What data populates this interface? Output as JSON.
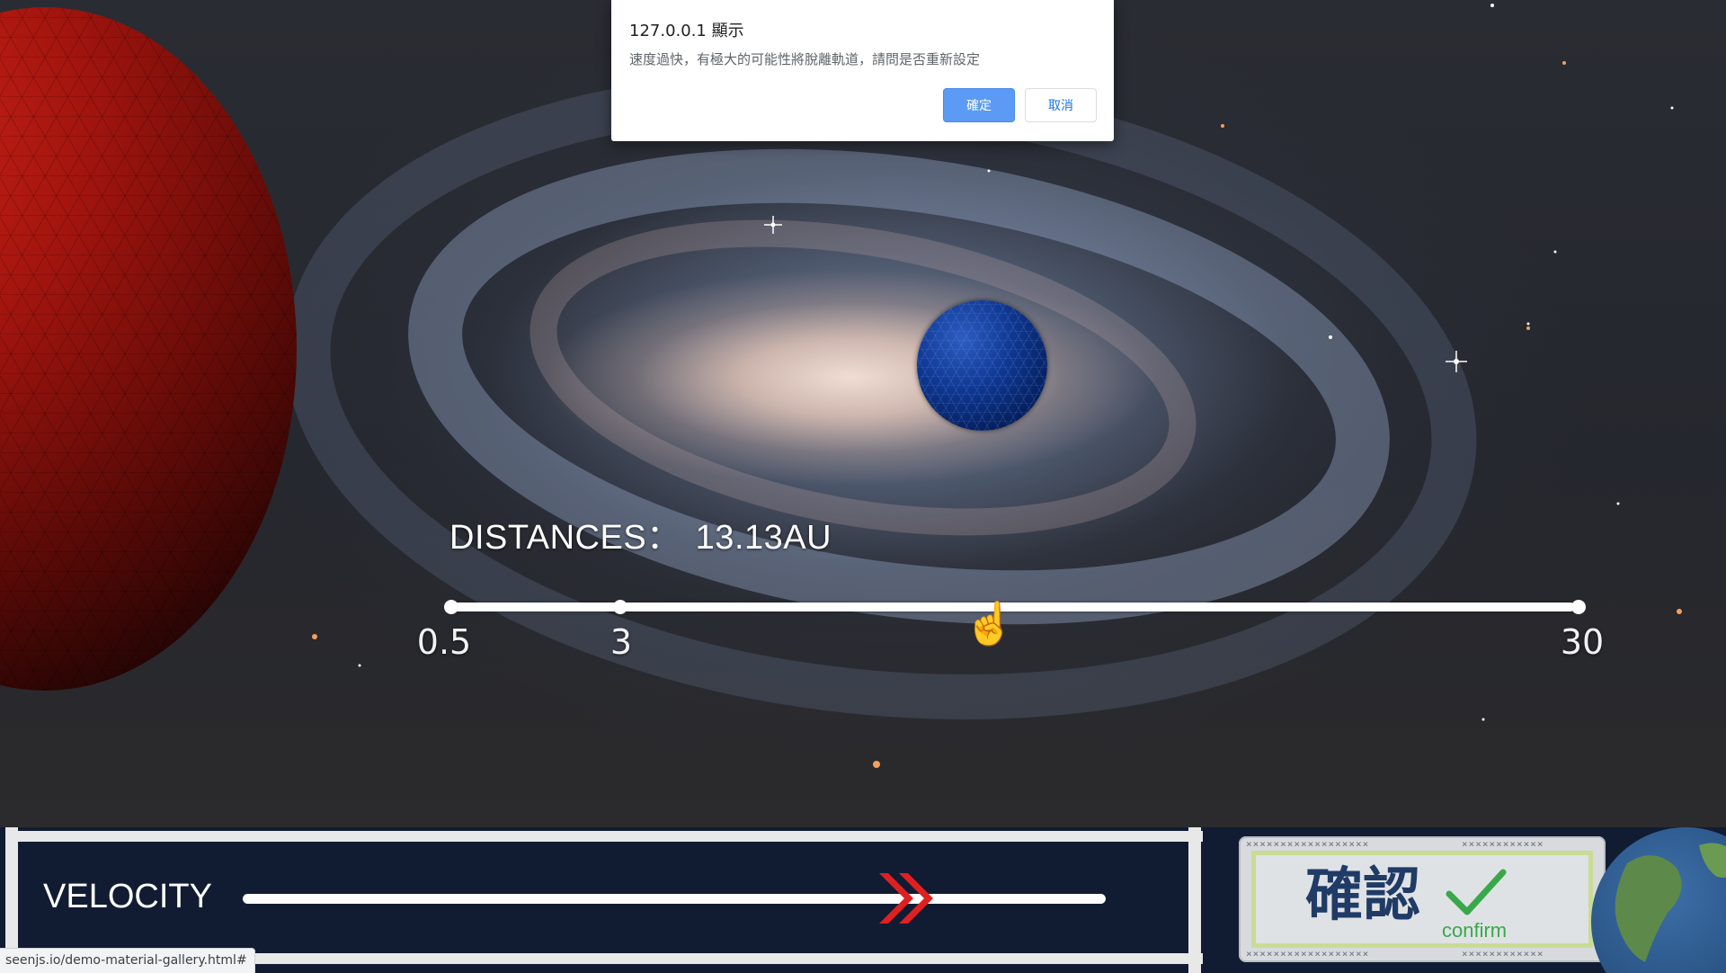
{
  "alert": {
    "title": "127.0.0.1 顯示",
    "message": "速度過快，有極大的可能性將脫離軌道，請問是否重新設定",
    "ok_label": "確定",
    "cancel_label": "取消"
  },
  "distance": {
    "label": "DISTANCES：",
    "value": "13.13AU",
    "slider": {
      "min_label": "0.5",
      "mid_label": "3",
      "max_label": "30"
    }
  },
  "velocity": {
    "label": "VELOCITY"
  },
  "confirm_button": {
    "label_zh": "確認",
    "label_en": "confirm"
  },
  "status_bar": {
    "url": "seenjs.io/demo-material-gallery.html#"
  },
  "colors": {
    "alert_ok": "#5b9bf5",
    "panel": "#111c33",
    "velocity_thumb": "#e02020",
    "confirm_text": "#1f3b66",
    "confirm_accent": "#3aa84a"
  },
  "icons": {
    "distance_thumb": "pointing-hand-icon",
    "velocity_thumb": "double-chevron-right-icon",
    "confirm_check": "check-icon"
  }
}
